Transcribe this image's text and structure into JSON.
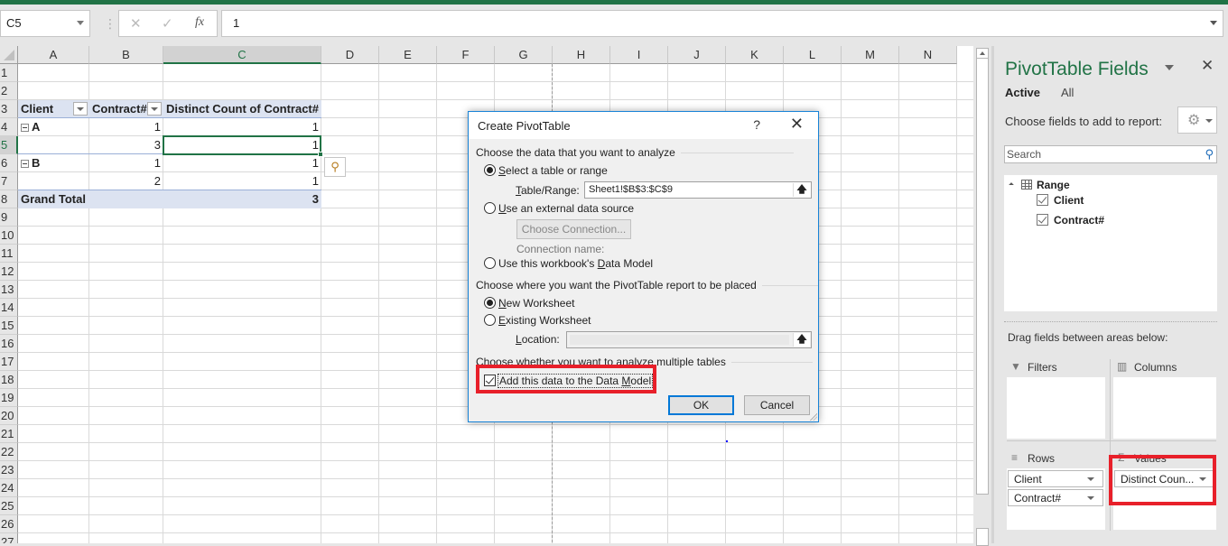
{
  "formula_bar": {
    "name_box": "C5",
    "cancel_icon": "✕",
    "enter_icon": "✓",
    "fx_label": "fx",
    "formula_value": "1"
  },
  "sheet": {
    "columns": [
      "A",
      "B",
      "C",
      "D",
      "E",
      "F",
      "G",
      "H",
      "I",
      "J",
      "K",
      "L",
      "M",
      "N"
    ],
    "selected_column": "C",
    "rows": [
      "1",
      "2",
      "3",
      "4",
      "5",
      "6",
      "7",
      "8",
      "9",
      "10",
      "11",
      "12",
      "13",
      "14",
      "15",
      "16",
      "17",
      "18",
      "19",
      "20",
      "21",
      "22",
      "23",
      "24",
      "25",
      "26",
      "27"
    ],
    "selected_row": "5",
    "selected_cell": "C5"
  },
  "pivot": {
    "headers": [
      "Client",
      "Contract#",
      "Distinct Count of Contract#"
    ],
    "rows": [
      {
        "client": "A",
        "contract": "1",
        "count": "1"
      },
      {
        "client": "",
        "contract": "3",
        "count": "1"
      },
      {
        "client": "B",
        "contract": "1",
        "count": "1"
      },
      {
        "client": "",
        "contract": "2",
        "count": "1"
      }
    ],
    "total_label": "Grand Total",
    "total_value": "3"
  },
  "dialog": {
    "title": "Create PivotTable",
    "help": "?",
    "close": "✕",
    "section1": "Choose the data that you want to analyze",
    "opt_table": {
      "pre": "",
      "u": "S",
      "post": "elect a table or range",
      "selected": true
    },
    "table_range_label": {
      "u": "T",
      "post": "able/Range:"
    },
    "table_range_value": "Sheet1!$B$3:$C$9",
    "opt_external": {
      "u": "U",
      "post": "se an external data source",
      "selected": false
    },
    "choose_connection": "Choose Connection...",
    "connection_name": "Connection name:",
    "opt_model": {
      "pre": "Use this workbook's ",
      "u": "D",
      "post": "ata Model",
      "selected": false
    },
    "section2": "Choose where you want the PivotTable report to be placed",
    "opt_new": {
      "u": "N",
      "post": "ew Worksheet",
      "selected": true
    },
    "opt_existing": {
      "u": "E",
      "post": "xisting Worksheet",
      "selected": false
    },
    "location_label": {
      "u": "L",
      "post": "ocation:"
    },
    "location_value": "",
    "section3": "Choose whether you want to analyze multiple tables",
    "add_model": {
      "pre": "Add this data to the Data ",
      "u": "M",
      "post": "odel",
      "checked": true
    },
    "ok": "OK",
    "cancel": "Cancel"
  },
  "pane": {
    "title": "PivotTable Fields",
    "tabs": [
      "Active",
      "All"
    ],
    "active_tab": "Active",
    "choose_label": "Choose fields to add to report:",
    "search_placeholder": "Search",
    "table_name": "Range",
    "fields": [
      {
        "name": "Client",
        "checked": true
      },
      {
        "name": "Contract#",
        "checked": true
      }
    ],
    "drag_label": "Drag fields between areas below:",
    "areas": {
      "filters": {
        "label": "Filters",
        "items": []
      },
      "columns": {
        "label": "Columns",
        "items": []
      },
      "rows": {
        "label": "Rows",
        "items": [
          "Client",
          "Contract#"
        ]
      },
      "values": {
        "label": "Values",
        "items": [
          "Distinct Coun..."
        ]
      }
    }
  },
  "colors": {
    "excel_green": "#217346",
    "highlight_red": "#e8202a",
    "pivot_header": "#dce3f1",
    "dialog_accent": "#0078d7"
  }
}
